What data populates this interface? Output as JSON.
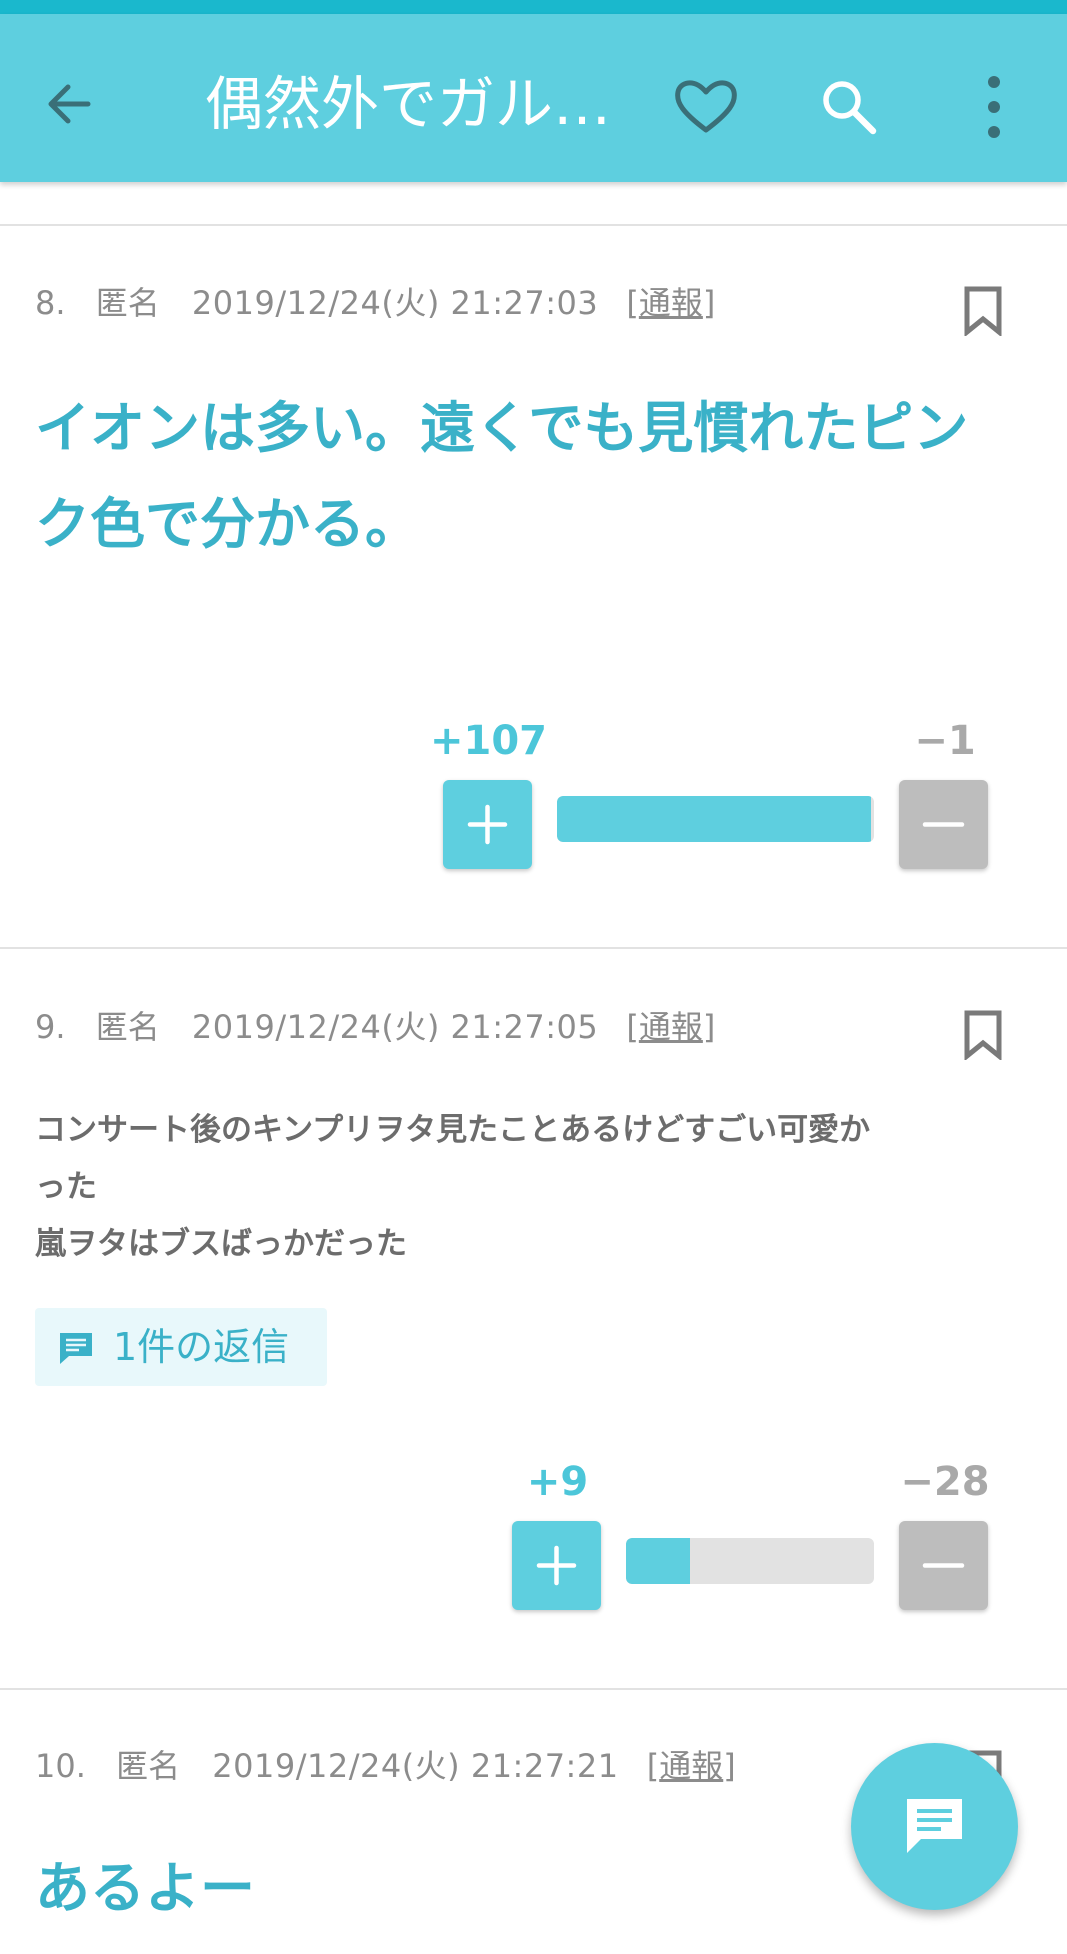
{
  "appbar": {
    "title": "偶然外でガル…",
    "icons": [
      "arrow-back-icon",
      "heart-outline-icon",
      "search-icon",
      "more-vert-icon"
    ]
  },
  "colors": {
    "accent": "#5ecfdf",
    "accent_text": "#3ab1c8",
    "minus_button": "#bdbdbd",
    "meta_text": "#8c8c8c"
  },
  "comments": [
    {
      "number": "8.",
      "name": "匿名",
      "date": "2019/12/24(火) 21:27:03",
      "report_open": "[",
      "report": "通報",
      "report_close": "]",
      "body": "イオンは多い。遠くでも見慣れたピンク色で分かる。",
      "plus": "+107",
      "minus": "−1",
      "plus_ratio": 0.99
    },
    {
      "number": "9.",
      "name": "匿名",
      "date": "2019/12/24(火) 21:27:05",
      "report_open": "[",
      "report": "通報",
      "report_close": "]",
      "body_lines": [
        "コンサート後のキンプリヲタ見たことあるけどすごい可愛か",
        "った",
        "嵐ヲタはブスばっかだった"
      ],
      "replies": "1件の返信",
      "plus": "+9",
      "minus": "−28",
      "plus_ratio": 0.26
    },
    {
      "number": "10.",
      "name": "匿名",
      "date": "2019/12/24(火) 21:27:21",
      "report_open": "[",
      "report": "通報",
      "report_close": "]",
      "body": "あるよー"
    }
  ]
}
